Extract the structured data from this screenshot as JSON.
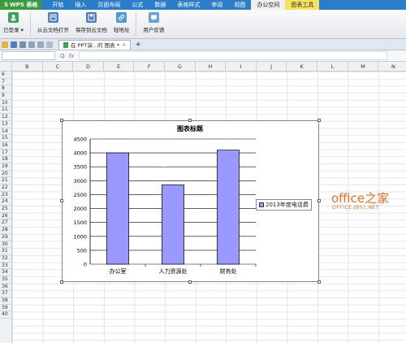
{
  "menubar": {
    "app_label": "WPS 表格",
    "items": [
      {
        "label": "开始"
      },
      {
        "label": "插入"
      },
      {
        "label": "页面布局"
      },
      {
        "label": "公式"
      },
      {
        "label": "数据"
      },
      {
        "label": "表格样式"
      },
      {
        "label": "审阅"
      },
      {
        "label": "视图"
      },
      {
        "label": "办公空间",
        "active": true
      },
      {
        "label": "图表工具",
        "tool": true
      }
    ]
  },
  "ribbon": {
    "buttons": [
      {
        "label": "已登录 ▾",
        "icon": "user-icon",
        "color": "#3aa35a"
      },
      {
        "label": "从云文档打开",
        "icon": "cloud-open-icon",
        "color": "#4a7fc0"
      },
      {
        "label": "保存到云文档",
        "icon": "cloud-save-icon",
        "color": "#4a7fc0"
      },
      {
        "label": "轻地址",
        "icon": "link-icon",
        "color": "#4a9ad6"
      },
      {
        "label": "用户反馈",
        "icon": "feedback-icon",
        "color": "#6aa0d8"
      }
    ]
  },
  "tabs": {
    "doc_title": "在 PPT演...的 图表 *",
    "close": "×",
    "new_tab": "+"
  },
  "formula_bar": {
    "fx": "fx",
    "q": "Q"
  },
  "columns": [
    "B",
    "C",
    "D",
    "E",
    "F",
    "G",
    "H",
    "I",
    "J",
    "K",
    "L",
    "M",
    "N"
  ],
  "rows": [
    "6",
    "7",
    "8",
    "9",
    "10",
    "11",
    "12",
    "13",
    "14",
    "15",
    "16",
    "17",
    "18",
    "19",
    "20",
    "21",
    "22",
    "23",
    "24",
    "25",
    "26",
    "27",
    "28",
    "29",
    "30",
    "31",
    "32",
    "33",
    "34",
    "35",
    "36",
    "37",
    "38",
    "39",
    "40"
  ],
  "chart_data": {
    "type": "bar",
    "title": "图表标题",
    "categories": [
      "办公室",
      "人力资源处",
      "财务处"
    ],
    "series": [
      {
        "name": "2013年度电话费",
        "values": [
          4000,
          2850,
          4100
        ],
        "color": "#9999ff"
      }
    ],
    "ylim": [
      0,
      4500
    ],
    "yticks": [
      "0",
      "500",
      "1000",
      "1500",
      "2000",
      "2500",
      "3000",
      "3500",
      "4000",
      "4500"
    ],
    "grid": true,
    "legend": "right"
  },
  "watermark": {
    "logo_latin": "office",
    "logo_cn": "之家",
    "url": "OFFICE.JB51.NET",
    "overlay": "NE"
  }
}
